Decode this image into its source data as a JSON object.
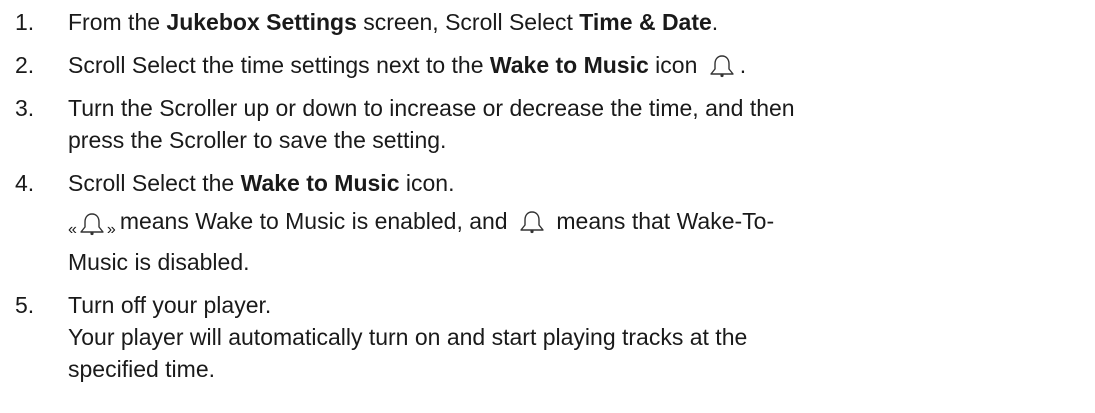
{
  "steps": [
    {
      "num": "1.",
      "a": "From the ",
      "b": "Jukebox Settings",
      "c": " screen, Scroll Select ",
      "d": "Time & Date",
      "e": "."
    },
    {
      "num": "2.",
      "a": "Scroll Select the time settings next to the ",
      "b": "Wake to Music",
      "c": " icon",
      "e": "."
    },
    {
      "num": "3.",
      "a": "Turn the Scroller up or down to increase or decrease the time, and then",
      "b": "press the Scroller to save the setting."
    },
    {
      "num": "4.",
      "a": "Scroll Select the ",
      "b": "Wake to Music",
      "c": " icon.",
      "d": "means Wake to Music is enabled, and ",
      "e": " means that Wake-To-",
      "f": "Music is disabled.",
      "chev_l": "«",
      "chev_r": "»"
    },
    {
      "num": "5.",
      "a": "Turn off your player.",
      "b": "Your player will automatically turn on and start playing tracks at the",
      "c": "specified time."
    }
  ],
  "icons": {
    "bell": "bell-icon",
    "bell_enabled": "bell-enabled-icon"
  }
}
